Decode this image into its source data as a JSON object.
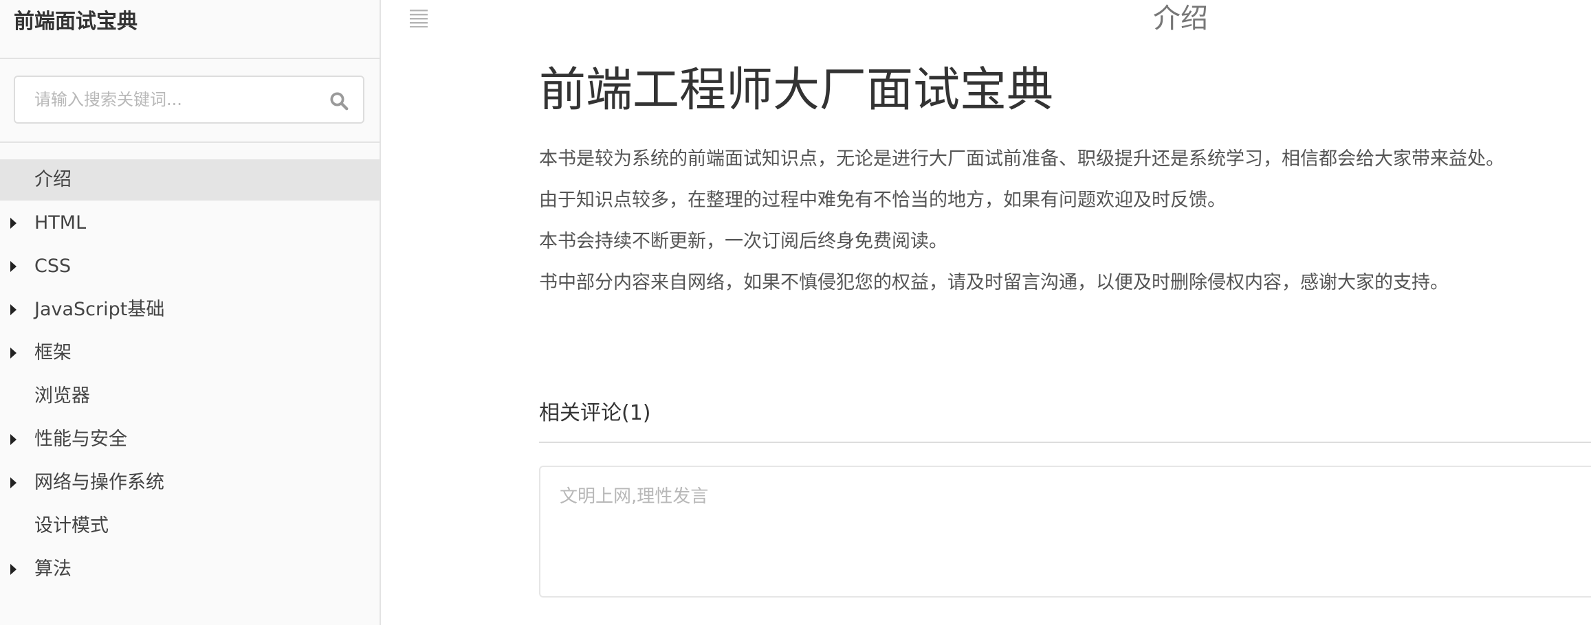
{
  "sidebar": {
    "brand": "前端面试宝典",
    "search_placeholder": "请输入搜索关键词...",
    "items": [
      {
        "label": "介绍",
        "has_children": false,
        "active": true
      },
      {
        "label": "HTML",
        "has_children": true,
        "active": false
      },
      {
        "label": "CSS",
        "has_children": true,
        "active": false
      },
      {
        "label": "JavaScript基础",
        "has_children": true,
        "active": false
      },
      {
        "label": "框架",
        "has_children": true,
        "active": false
      },
      {
        "label": "浏览器",
        "has_children": false,
        "active": false
      },
      {
        "label": "性能与安全",
        "has_children": true,
        "active": false
      },
      {
        "label": "网络与操作系统",
        "has_children": true,
        "active": false
      },
      {
        "label": "设计模式",
        "has_children": false,
        "active": false
      },
      {
        "label": "算法",
        "has_children": true,
        "active": false
      }
    ]
  },
  "header": {
    "title": "介绍"
  },
  "main": {
    "title": "前端工程师大厂面试宝典",
    "paragraphs": [
      "本书是较为系统的前端面试知识点，无论是进行大厂面试前准备、职级提升还是系统学习，相信都会给大家带来益处。",
      "由于知识点较多，在整理的过程中难免有不恰当的地方，如果有问题欢迎及时反馈。",
      "本书会持续不断更新，一次订阅后终身免费阅读。",
      "书中部分内容来自网络，如果不慎侵犯您的权益，请及时留言沟通，以便及时删除侵权内容，感谢大家的支持。"
    ],
    "comments_heading": "相关评论(1)",
    "comment_placeholder": "文明上网,理性发言"
  },
  "colors": {
    "sidebar_bg": "#fafafa",
    "active_item_bg": "#e4e4e4",
    "border": "#e3e3e3",
    "placeholder": "#b8b8b8"
  }
}
